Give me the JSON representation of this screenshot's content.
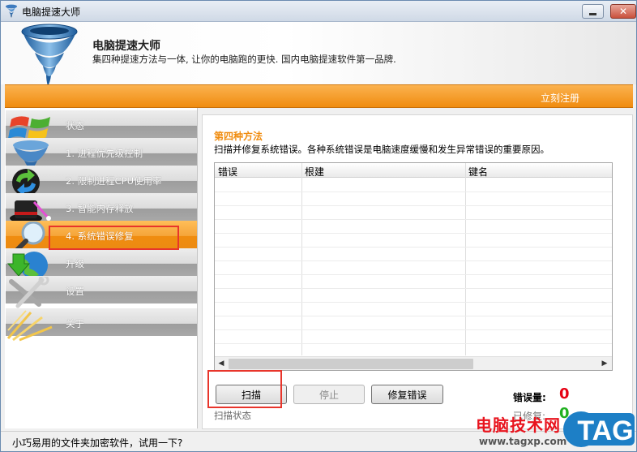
{
  "window": {
    "title": "电脑提速大师"
  },
  "header": {
    "app_name": "电脑提速大师",
    "slogan": "集四种提速方法与一体, 让你的电脑跑的更快. 国内电脑提速软件第一品牌."
  },
  "orange_bar": {
    "register_label": "立刻注册"
  },
  "sidebar": {
    "items": [
      {
        "label": "状态",
        "icon": "windows-logo-icon",
        "active": false
      },
      {
        "label": "1. 进程优先级控制",
        "icon": "tornado-icon",
        "active": false
      },
      {
        "label": "2. 限制进程CPU使用率",
        "icon": "sync-arrows-icon",
        "active": false
      },
      {
        "label": "3. 智能内存释放",
        "icon": "magic-hat-icon",
        "active": false
      },
      {
        "label": "4. 系统错误修复",
        "icon": "magnifier-icon",
        "active": true
      },
      {
        "label": "升级",
        "icon": "globe-download-icon",
        "active": false
      },
      {
        "label": "设置",
        "icon": "wrench-tools-icon",
        "active": false
      },
      {
        "label": "关于",
        "icon": "info-lights-icon",
        "active": false
      }
    ]
  },
  "main": {
    "section_title": "第四种方法",
    "section_desc": "扫描并修复系统错误。各种系统错误是电脑速度缓慢和发生异常错误的重要原因。",
    "table": {
      "columns": [
        "错误",
        "根建",
        "键名"
      ],
      "rows": []
    },
    "buttons": {
      "scan": "扫描",
      "stop": "停止",
      "fix": "修复错误"
    },
    "scan_status": "扫描状态",
    "error_count_label": "错误量:",
    "error_count": "0",
    "fixed_count_label": "已修复:",
    "fixed_count": "0"
  },
  "statusbar": {
    "text": "小巧易用的文件夹加密软件，试用一下?"
  },
  "watermark": {
    "text": "电脑技术网",
    "url": "www.tagxp.com",
    "badge": "TAG"
  },
  "colors": {
    "accent_orange": "#f08c0f",
    "error_red": "#e60012",
    "fixed_green": "#20b020",
    "annotation_red": "#e8352b",
    "badge_blue": "#1d7fc6"
  }
}
